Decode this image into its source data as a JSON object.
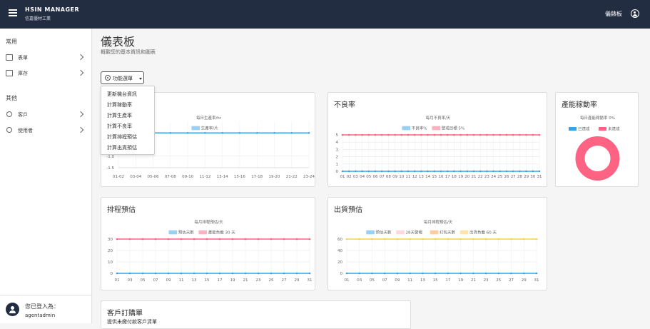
{
  "app": {
    "title": "HSIN MANAGER",
    "subtitle": "信嘉優材工業",
    "top_right": "儀錶板"
  },
  "sidebar": {
    "sections": [
      {
        "title": "常用",
        "items": [
          {
            "label": "表單"
          },
          {
            "label": "庫存"
          }
        ]
      },
      {
        "title": "其他",
        "items": [
          {
            "label": "客戶"
          },
          {
            "label": "使用者"
          }
        ]
      }
    ],
    "user": {
      "label": "您已登入為：",
      "name": "agentadmin"
    }
  },
  "page": {
    "title": "儀表板",
    "subtitle": "概觀您的基本資訊和圖表"
  },
  "function_menu": {
    "label": "功能選單",
    "items": [
      "更新機台資訊",
      "計算稼動率",
      "計算生產率",
      "計算不良率",
      "計算排程預估",
      "計算出貨預估"
    ]
  },
  "colors": {
    "blue": "#36a2eb",
    "pink": "#ff6384",
    "orange": "#ff9f40",
    "yellow": "#ffcd56",
    "light_pink": "#ffb1c1"
  },
  "chart_data": [
    {
      "type": "line",
      "title": "",
      "subtitle": "每日生產率/hr",
      "categories": [
        "01-02",
        "03-04",
        "05-06",
        "07-08",
        "09-10",
        "11-12",
        "13-14",
        "15-16",
        "17-18",
        "19-20",
        "21-22",
        "23-24"
      ],
      "series": [
        {
          "name": "生產率/片",
          "values": [
            0,
            0,
            0,
            0,
            0,
            0,
            0,
            0,
            0,
            0,
            0,
            0
          ],
          "color": "#36a2eb"
        }
      ],
      "y_ticks": [
        "-1.0",
        "-1.5"
      ],
      "ylim": [
        -1.5,
        0.5
      ]
    },
    {
      "type": "line",
      "title": "不良率",
      "subtitle": "每月不良率/天",
      "categories": [
        "01",
        "02",
        "03",
        "04",
        "05",
        "06",
        "07",
        "08",
        "09",
        "10",
        "11",
        "12",
        "13",
        "14",
        "15",
        "16",
        "17",
        "18",
        "19",
        "20",
        "21",
        "22",
        "23",
        "24",
        "25",
        "26",
        "27",
        "28",
        "29",
        "30",
        "31"
      ],
      "series": [
        {
          "name": "不良率%",
          "values": [
            0,
            0,
            0,
            0,
            0,
            0,
            0,
            0,
            0,
            0,
            0,
            0,
            0,
            0,
            0,
            0,
            0,
            0,
            0,
            0,
            0,
            0,
            0,
            0,
            0,
            0,
            0,
            0,
            0,
            0,
            0
          ],
          "color": "#36a2eb"
        },
        {
          "name": "警戒目標 5%",
          "values": [
            5,
            5,
            5,
            5,
            5,
            5,
            5,
            5,
            5,
            5,
            5,
            5,
            5,
            5,
            5,
            5,
            5,
            5,
            5,
            5,
            5,
            5,
            5,
            5,
            5,
            5,
            5,
            5,
            5,
            5,
            5
          ],
          "color": "#ff6384"
        }
      ],
      "y_ticks": [
        "0",
        "1",
        "2",
        "3",
        "4",
        "5"
      ],
      "ylim": [
        0,
        5
      ]
    },
    {
      "type": "pie",
      "title": "產能稼動率",
      "subtitle": "每日產能稼動率 0%",
      "labels": [
        "已達成",
        "未達成"
      ],
      "values": [
        0,
        100
      ],
      "colors": [
        "#36a2eb",
        "#ff6384"
      ]
    },
    {
      "type": "line",
      "title": "排程預估",
      "subtitle": "每月排程預估/天",
      "categories": [
        "01",
        "03",
        "05",
        "07",
        "09",
        "11",
        "13",
        "15",
        "17",
        "19",
        "21",
        "23",
        "25",
        "27",
        "29",
        "31"
      ],
      "series": [
        {
          "name": "預估天數",
          "values": [
            0,
            0,
            0,
            0,
            0,
            0,
            0,
            0,
            0,
            0,
            0,
            0,
            0,
            0,
            0,
            0
          ],
          "color": "#36a2eb"
        },
        {
          "name": "產能負載 30 天",
          "values": [
            30,
            30,
            30,
            30,
            30,
            30,
            30,
            30,
            30,
            30,
            30,
            30,
            30,
            30,
            30,
            30
          ],
          "color": "#ff6384"
        }
      ],
      "y_ticks": [
        "0",
        "10",
        "20",
        "30"
      ],
      "ylim": [
        0,
        30
      ]
    },
    {
      "type": "line",
      "title": "出貨預估",
      "subtitle": "每月排程預估/天",
      "categories": [
        "01",
        "03",
        "05",
        "07",
        "09",
        "11",
        "13",
        "15",
        "17",
        "19",
        "21",
        "23",
        "25",
        "27",
        "29",
        "31"
      ],
      "series": [
        {
          "name": "預估天數",
          "values": [
            0,
            0,
            0,
            0,
            0,
            0,
            0,
            0,
            0,
            0,
            0,
            0,
            0,
            0,
            0,
            0
          ],
          "color": "#36a2eb"
        },
        {
          "name": "28天警報",
          "values": [],
          "color": "#ffb1c1"
        },
        {
          "name": "打包天數",
          "values": [],
          "color": "#ff9f40"
        },
        {
          "name": "出貨負載 60 天",
          "values": [
            60,
            60,
            60,
            60,
            60,
            60,
            60,
            60,
            60,
            60,
            60,
            60,
            60,
            60,
            60,
            60
          ],
          "color": "#ffcd56"
        }
      ],
      "y_ticks": [
        "0",
        "20",
        "40",
        "60"
      ],
      "ylim": [
        0,
        60
      ]
    }
  ],
  "orders": {
    "title": "客戶訂購單",
    "subtitle": "提供未繳付款客戶清單"
  }
}
